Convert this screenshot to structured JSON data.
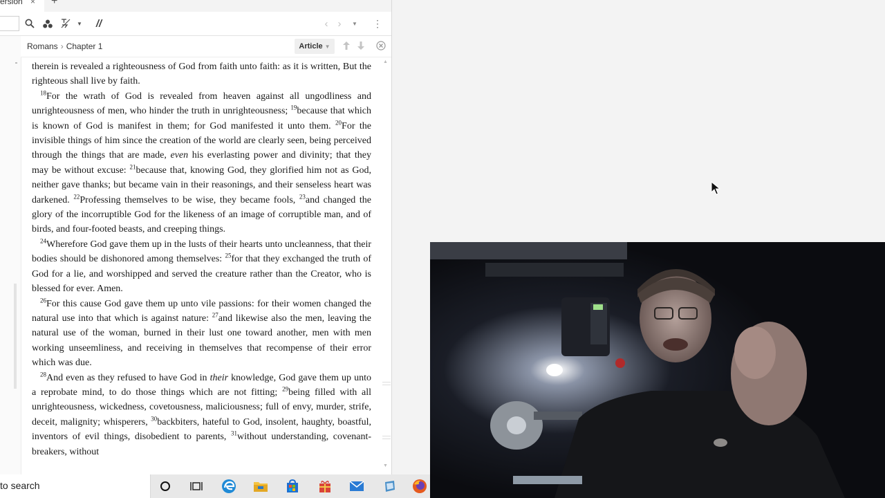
{
  "window": {
    "tab_label": "ersion",
    "tab_close": "×",
    "new_tab": "+"
  },
  "toolbar": {
    "search_icon": "search-icon",
    "resources_icon": "resources-icon",
    "filter_icon": "filter-icon",
    "parallel_label": "//"
  },
  "panel": {
    "book": "Romans",
    "chapter": "Chapter 1",
    "view_mode": "Article"
  },
  "passage": [
    {
      "n": "",
      "segments": [
        {
          "t": "therein is revealed a righteousness of God from faith unto faith: as it is written, But the righteous shall live by faith.",
          "i": false
        }
      ]
    },
    {
      "n": "18",
      "segments": [
        {
          "t": "For the wrath of God is revealed from heaven against all ungodliness and unrighteousness of men, who hinder the truth in unrighteousness; ",
          "i": false
        },
        {
          "t": "19",
          "v": true
        },
        {
          "t": "because that which is known of God is manifest in them; for God manifested it unto them. ",
          "i": false
        },
        {
          "t": "20",
          "v": true
        },
        {
          "t": "For the invisible things of him since the creation of the world are clearly seen, being perceived through the things that are made, ",
          "i": false
        },
        {
          "t": "even",
          "i": true
        },
        {
          "t": " his everlasting power and divinity; that they may be without excuse: ",
          "i": false
        },
        {
          "t": "21",
          "v": true
        },
        {
          "t": "because that, knowing God, they glorified him not as God, neither gave thanks; but became vain in their reasonings, and their senseless heart was darkened. ",
          "i": false
        },
        {
          "t": "22",
          "v": true
        },
        {
          "t": "Professing themselves to be wise, they became fools, ",
          "i": false
        },
        {
          "t": "23",
          "v": true
        },
        {
          "t": "and changed the glory of the incorruptible God for the likeness of an image of corruptible man, and of birds, and four-footed beasts, and creeping things.",
          "i": false
        }
      ]
    },
    {
      "n": "24",
      "segments": [
        {
          "t": "Wherefore God gave them up in the lusts of their hearts unto uncleanness, that their bodies should be dishonored among themselves: ",
          "i": false
        },
        {
          "t": "25",
          "v": true
        },
        {
          "t": "for that they exchanged the truth of God for a lie, and worshipped and served the creature rather than the Creator, who is blessed for ever. Amen.",
          "i": false
        }
      ]
    },
    {
      "n": "26",
      "segments": [
        {
          "t": "For this cause God gave them up unto vile passions: for their women changed the natural use into that which is against nature: ",
          "i": false
        },
        {
          "t": "27",
          "v": true
        },
        {
          "t": "and likewise also the men, leaving the natural use of the woman, burned in their lust one toward another, men with men working unseemliness, and receiving in themselves that recompense of their error which was due.",
          "i": false
        }
      ]
    },
    {
      "n": "28",
      "segments": [
        {
          "t": "And even as they refused to have God in ",
          "i": false
        },
        {
          "t": "their",
          "i": true
        },
        {
          "t": " knowledge, God gave them up unto a reprobate mind, to do those things which are not fitting; ",
          "i": false
        },
        {
          "t": "29",
          "v": true
        },
        {
          "t": "being filled with all unrighteousness, wickedness, covetousness, maliciousness; full of envy, murder, strife, deceit, malignity; whisperers, ",
          "i": false
        },
        {
          "t": "30",
          "v": true
        },
        {
          "t": "backbiters, hateful to God, insolent, haughty, boastful, inventors of evil things, disobedient to parents, ",
          "i": false
        },
        {
          "t": "31",
          "v": true
        },
        {
          "t": "without understanding, covenant-breakers, without",
          "i": false
        }
      ]
    }
  ],
  "taskbar": {
    "search_text": "to search",
    "icons": [
      "cortana-icon",
      "task-view-icon",
      "edge-icon",
      "file-explorer-icon",
      "store-icon",
      "gift-icon",
      "mail-icon",
      "app-icon",
      "firefox-icon"
    ]
  },
  "colors": {
    "edge": "#1f8ad6",
    "folder": "#f5c342",
    "store": "#1f6fd1",
    "gift": "#d9443a",
    "mail": "#2a7bd4",
    "firefox": "#e55a1f"
  }
}
